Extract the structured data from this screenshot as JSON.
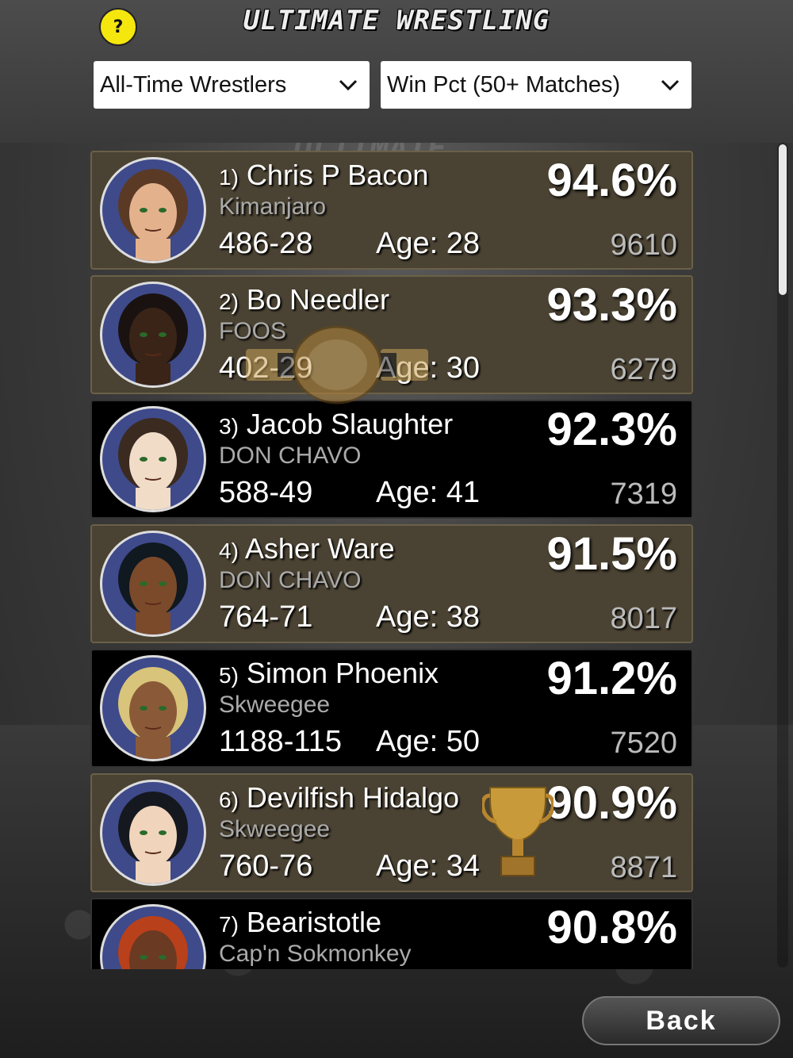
{
  "header": {
    "help_label": "?",
    "logo_text": "ULTIMATE WRESTLING"
  },
  "filters": {
    "category": "All-Time Wrestlers",
    "stat": "Win Pct (50+ Matches)"
  },
  "wrestlers": [
    {
      "rank": "1)",
      "name": "Chris P Bacon",
      "team": "Kimanjaro",
      "record": "486-28",
      "age": "Age: 28",
      "pct": "94.6%",
      "score": "9610",
      "style": "gold",
      "hair": "#5a3a25",
      "skin": "#e3b28c"
    },
    {
      "rank": "2)",
      "name": "Bo Needler",
      "team": "FOOS",
      "record": "402-29",
      "age": "Age: 30",
      "pct": "93.3%",
      "score": "6279",
      "style": "gold",
      "hair": "#1a1210",
      "skin": "#3a2418"
    },
    {
      "rank": "3)",
      "name": "Jacob Slaughter",
      "team": "DON CHAVO",
      "record": "588-49",
      "age": "Age: 41",
      "pct": "92.3%",
      "score": "7319",
      "style": "black",
      "hair": "#3b2a20",
      "skin": "#f1dcc8"
    },
    {
      "rank": "4)",
      "name": "Asher Ware",
      "team": "DON CHAVO",
      "record": "764-71",
      "age": "Age: 38",
      "pct": "91.5%",
      "score": "8017",
      "style": "gold",
      "hair": "#101820",
      "skin": "#7a4a2a"
    },
    {
      "rank": "5)",
      "name": "Simon Phoenix",
      "team": "Skweegee",
      "record": "1188-115",
      "age": "Age: 50",
      "pct": "91.2%",
      "score": "7520",
      "style": "black",
      "hair": "#d8c47a",
      "skin": "#8a5a38"
    },
    {
      "rank": "6)",
      "name": "Devilfish Hidalgo",
      "team": "Skweegee",
      "record": "760-76",
      "age": "Age: 34",
      "pct": "90.9%",
      "score": "8871",
      "style": "gold",
      "hair": "#15181e",
      "skin": "#f0d4bc"
    },
    {
      "rank": "7)",
      "name": "Bearistotle",
      "team": "Cap'n Sokmonkey",
      "record": "",
      "age": "",
      "pct": "90.8%",
      "score": "",
      "style": "black",
      "hair": "#b8401a",
      "skin": "#6a3a22"
    }
  ],
  "footer": {
    "back_label": "Back"
  },
  "colors": {
    "help_yellow": "#f5e60d",
    "row_gold": "#4a4232",
    "row_black": "#000000",
    "avatar_bg": "#3e4a8a"
  }
}
